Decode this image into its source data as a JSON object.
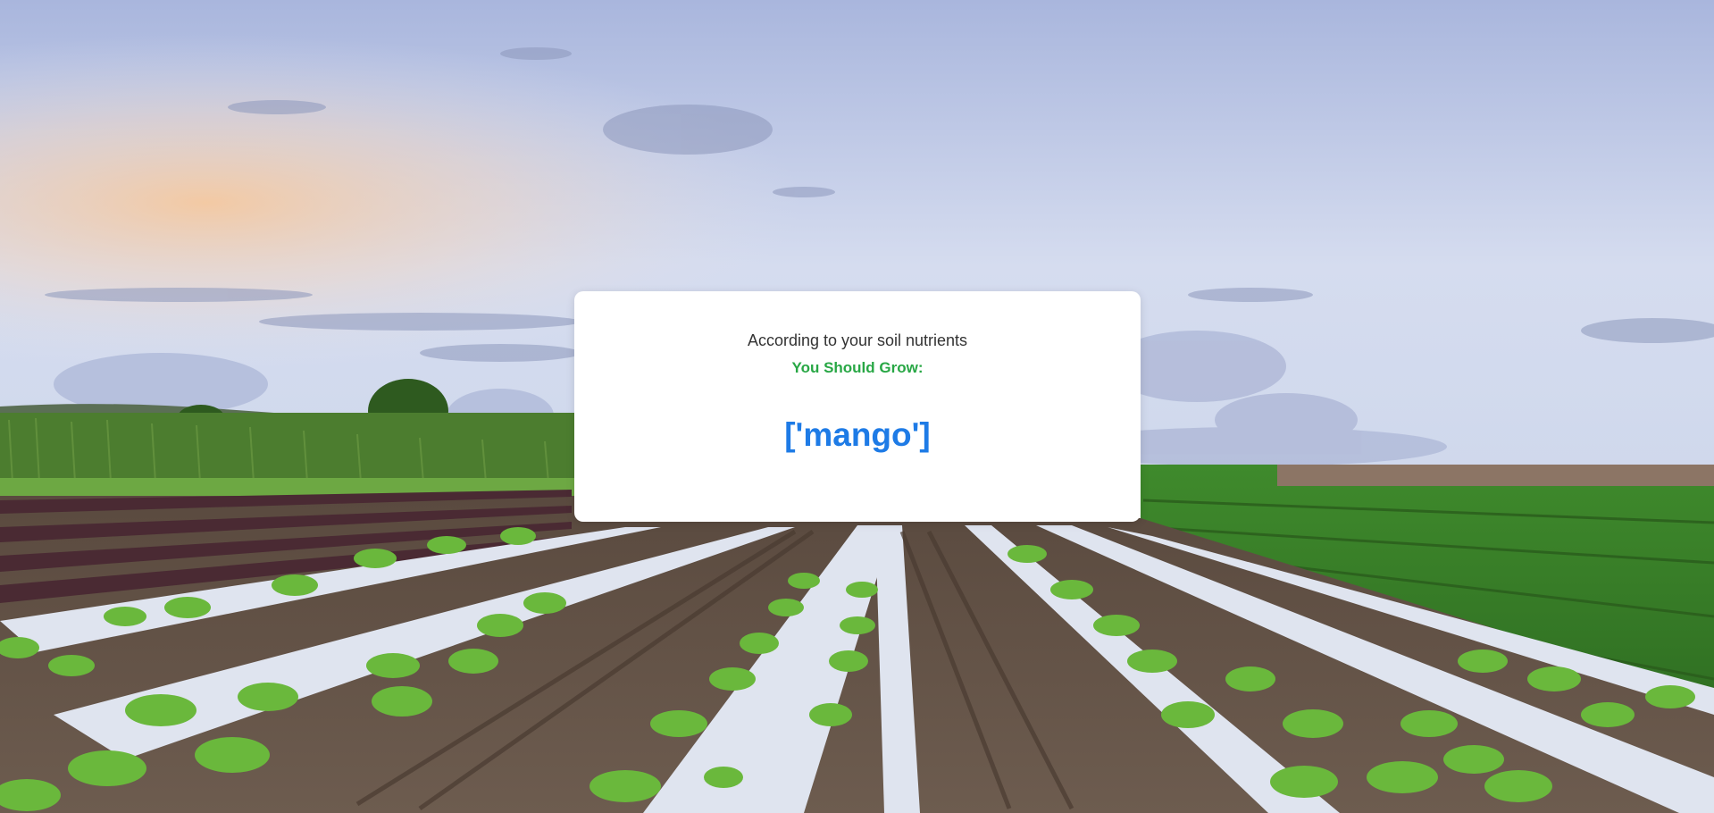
{
  "card": {
    "intro_text": "According to your soil nutrients",
    "heading": "You Should Grow:",
    "result": "['mango']"
  },
  "colors": {
    "heading": "#28a745",
    "result": "#1e7be6",
    "intro": "#333333",
    "card_bg": "#ffffff"
  }
}
